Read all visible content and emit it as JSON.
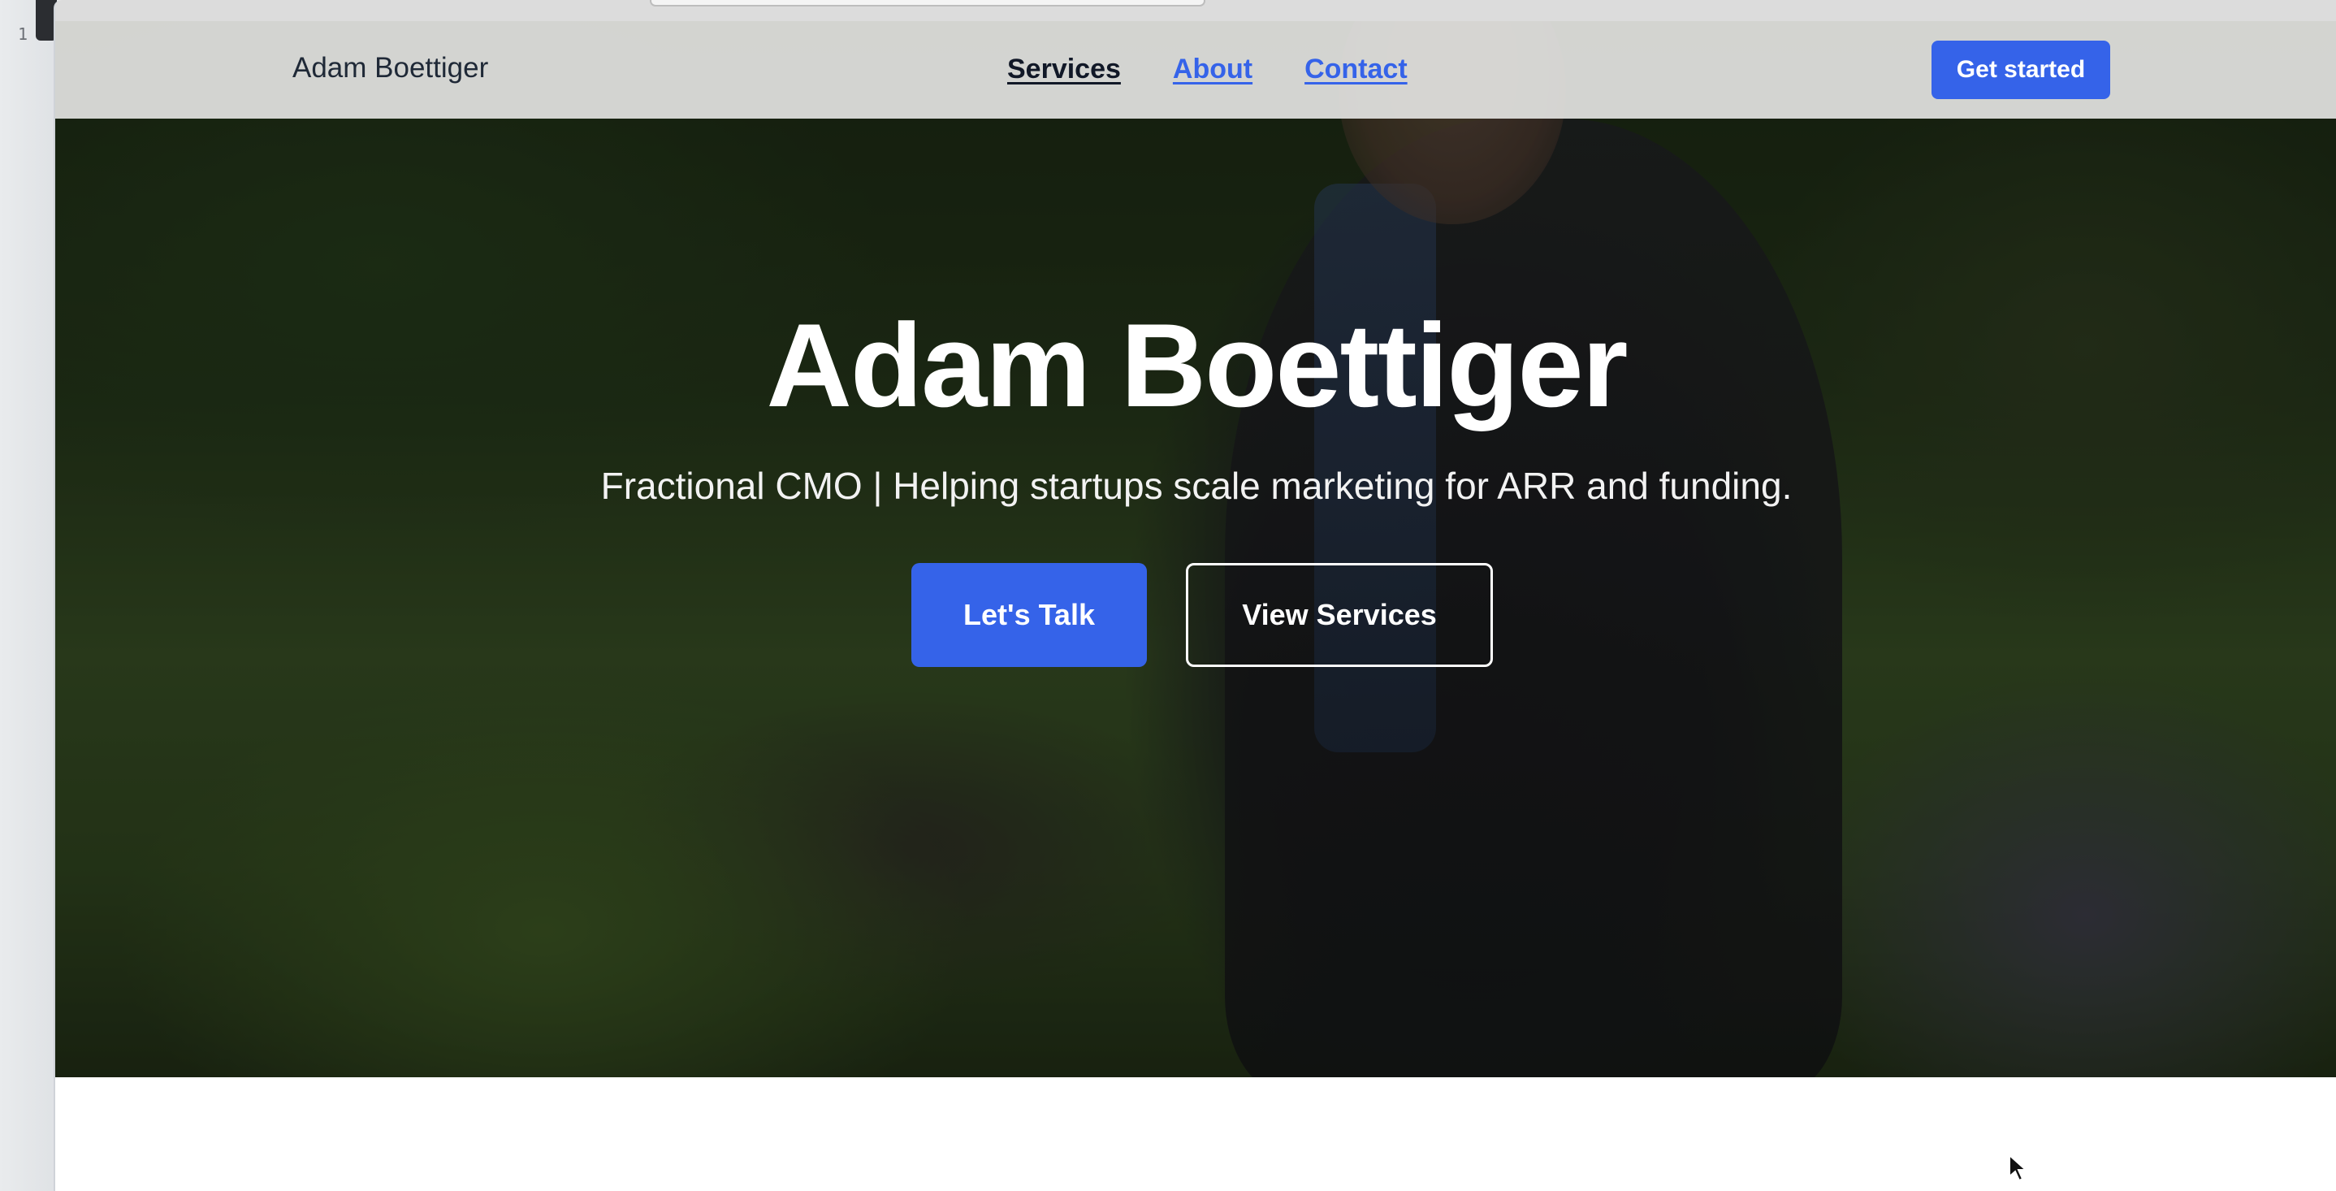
{
  "editor": {
    "line_number": "1"
  },
  "nav": {
    "brand": "Adam Boettiger",
    "links": [
      {
        "label": "Services",
        "active": true
      },
      {
        "label": "About",
        "active": false
      },
      {
        "label": "Contact",
        "active": false
      }
    ],
    "cta_label": "Get started"
  },
  "hero": {
    "title": "Adam Boettiger",
    "subtitle": "Fractional CMO | Helping startups scale marketing for ARR and funding.",
    "primary_button": "Let's Talk",
    "secondary_button": "View Services"
  },
  "colors": {
    "accent": "#3563e9",
    "nav_background": "#e2e2e0",
    "hero_text": "#ffffff"
  },
  "icons": {
    "cursor": "mouse-pointer-icon"
  }
}
